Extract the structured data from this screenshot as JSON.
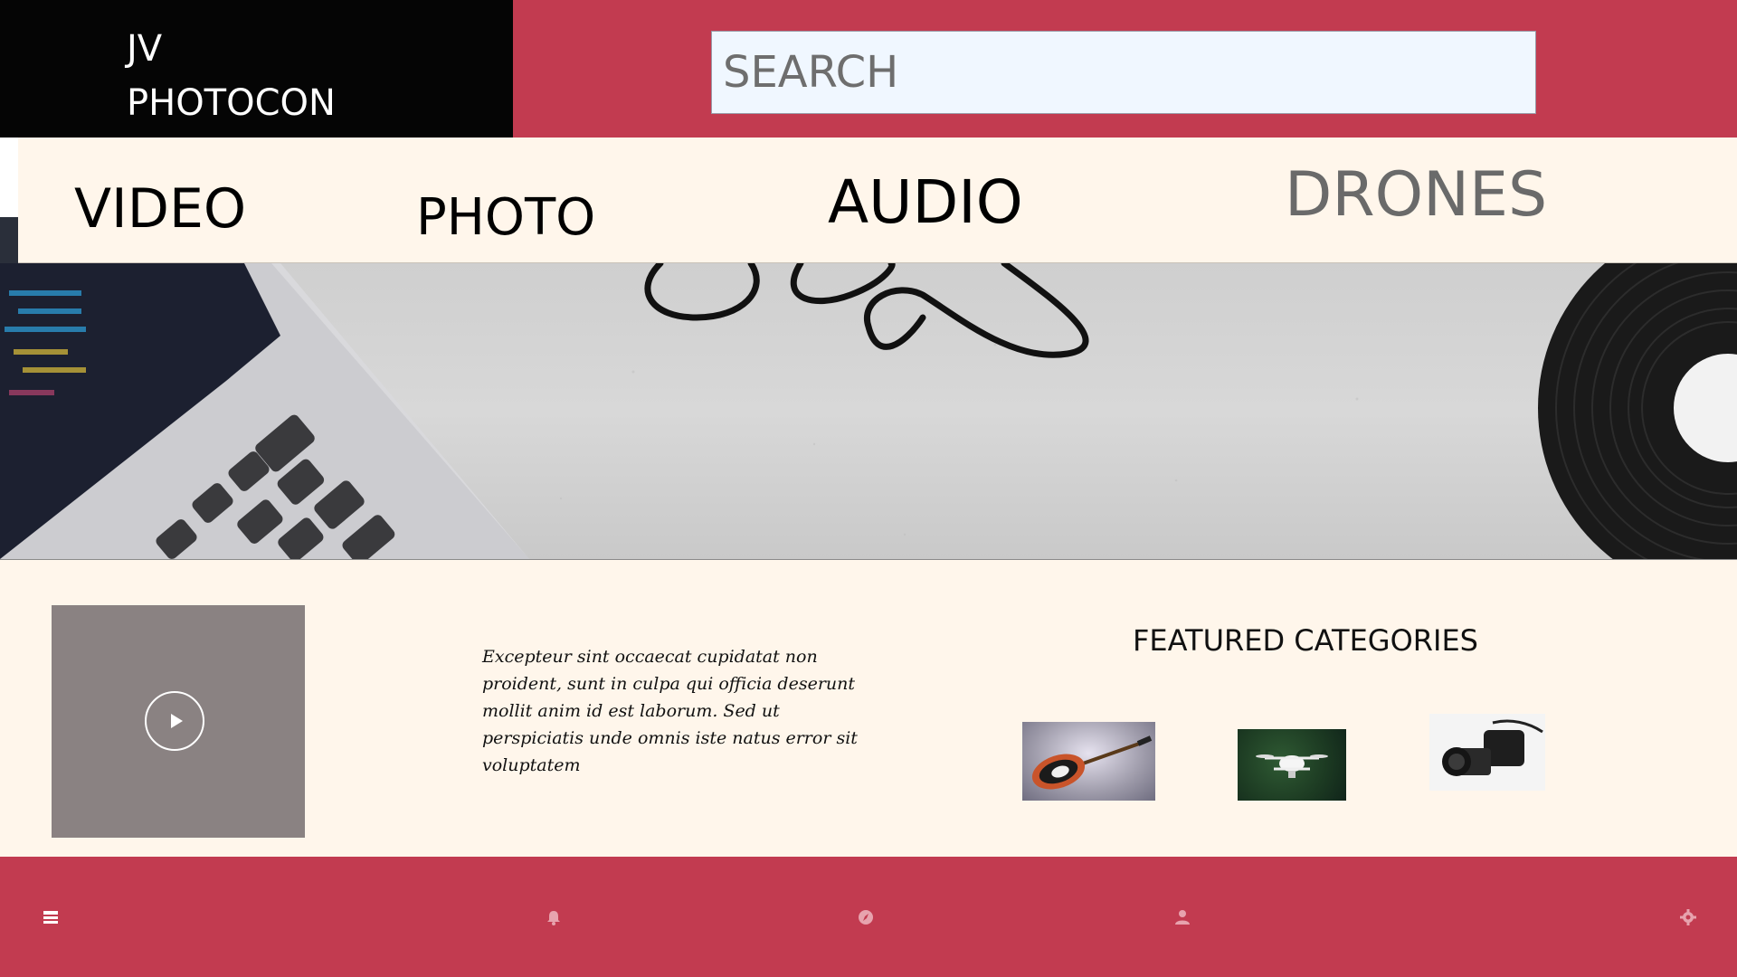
{
  "brand": {
    "line1": "JV",
    "line2": "PHOTOCON"
  },
  "search": {
    "placeholder": "SEARCH",
    "value": ""
  },
  "nav": {
    "items": [
      {
        "label": "VIDEO"
      },
      {
        "label": "PHOTO"
      },
      {
        "label": "AUDIO"
      },
      {
        "label": "DRONES"
      }
    ]
  },
  "main": {
    "paragraph": "Excepteur sint occaecat cupidatat non proident, sunt in culpa qui officia deserunt mollit anim id est laborum. Sed ut perspiciatis unde omnis iste natus error sit voluptatem",
    "featured": {
      "title": "FEATURED CATEGORIES",
      "items": [
        {
          "icon": "guitar-image"
        },
        {
          "icon": "drone-image"
        },
        {
          "icon": "camera-image"
        }
      ]
    }
  },
  "footer": {
    "icons": [
      "list-icon",
      "bell-icon",
      "compass-icon",
      "user-icon",
      "gear-icon"
    ]
  },
  "colors": {
    "accent": "#c23b50",
    "logo_bg": "#050505",
    "nav_bg": "#fff6eb",
    "search_bg": "#f0f7ff",
    "video_placeholder": "#8a8282"
  }
}
